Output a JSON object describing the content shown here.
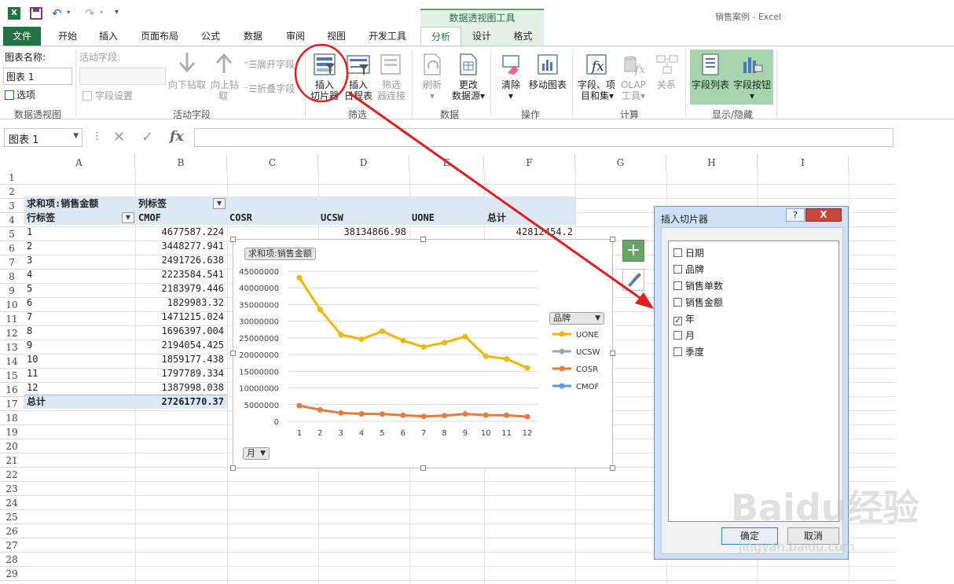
{
  "app": {
    "title": "销售案例 - Excel",
    "context_tab_group": "数据透视图工具"
  },
  "tabs": [
    {
      "label": "文件"
    },
    {
      "label": "开始"
    },
    {
      "label": "插入"
    },
    {
      "label": "页面布局"
    },
    {
      "label": "公式"
    },
    {
      "label": "数据"
    },
    {
      "label": "审阅"
    },
    {
      "label": "视图"
    },
    {
      "label": "开发工具"
    },
    {
      "label": "分析"
    },
    {
      "label": "设计"
    },
    {
      "label": "格式"
    }
  ],
  "ribbon": {
    "pivot": {
      "name_label": "图表名称:",
      "name_value": "图表 1",
      "options": "选项",
      "group": "数据透视图"
    },
    "active_field": {
      "label": "活动字段:",
      "field_settings": "字段设置",
      "drill_down": "向下钻取",
      "drill_up": "向上钻",
      "drill_up2": "取",
      "expand": "展开字段",
      "collapse": "折叠字段",
      "group": "活动字段"
    },
    "filter": {
      "slicer": "插入",
      "slicer2": "切片器",
      "timeline": "插入",
      "timeline2": "日程表",
      "connections": "筛选",
      "connections2": "器连接",
      "group": "筛选"
    },
    "data": {
      "refresh": "刷新",
      "change_source": "更改",
      "change_source2": "数据源",
      "group": "数据"
    },
    "actions": {
      "clear": "清除",
      "move_chart": "移动图表",
      "group": "操作"
    },
    "calc": {
      "fields_items": "字段、项",
      "fields_items2": "目和集",
      "olap": "OLAP",
      "olap2": "工具",
      "relations": "关系",
      "group": "计算"
    },
    "show_hide": {
      "field_list": "字段列表",
      "field_buttons": "字段按钮",
      "group": "显示/隐藏"
    }
  },
  "formula_bar": {
    "name_box": "图表 1",
    "fx": "fx",
    "formula": ""
  },
  "sheet": {
    "columns": [
      "A",
      "B",
      "C",
      "D",
      "E",
      "F",
      "G",
      "H",
      "I"
    ],
    "rows": [
      "1",
      "2",
      "3",
      "4",
      "5",
      "6",
      "7",
      "8",
      "9",
      "10",
      "11",
      "12",
      "13",
      "14",
      "15",
      "16",
      "17",
      "18",
      "19",
      "20",
      "21",
      "22",
      "23",
      "24",
      "25",
      "26",
      "27",
      "28",
      "29"
    ],
    "pivot_title": "求和项:销售金额",
    "col_labels": "列标签",
    "row_labels": "行标签",
    "col_headers": [
      "CMOF",
      "COSR",
      "UCSW",
      "UONE",
      "总计"
    ],
    "body": [
      {
        "row": "1",
        "cmof": "4677587.224",
        "ucsw": "38134866.98",
        "total": "42812454.2"
      },
      {
        "row": "2",
        "cmof": "3448277.941"
      },
      {
        "row": "3",
        "cmof": "2491726.638"
      },
      {
        "row": "4",
        "cmof": "2223584.541"
      },
      {
        "row": "5",
        "cmof": "2183979.446"
      },
      {
        "row": "6",
        "cmof": "1829983.32"
      },
      {
        "row": "7",
        "cmof": "1471215.024"
      },
      {
        "row": "8",
        "cmof": "1696397.004"
      },
      {
        "row": "9",
        "cmof": "2194054.425"
      },
      {
        "row": "10",
        "cmof": "1859177.438"
      },
      {
        "row": "11",
        "cmof": "1797789.334"
      },
      {
        "row": "12",
        "cmof": "1387998.038"
      }
    ],
    "grand_total_label": "总计",
    "grand_total_value": "27261770.37"
  },
  "chart_data": {
    "type": "line",
    "title_button": "求和项:销售金额",
    "legend_button": "品牌",
    "axis_button": "月",
    "categories": [
      "1",
      "2",
      "3",
      "4",
      "5",
      "6",
      "7",
      "8",
      "9",
      "10",
      "11",
      "12"
    ],
    "ylim": [
      0,
      45000000
    ],
    "yticks": [
      "45000000",
      "40000000",
      "35000000",
      "30000000",
      "25000000",
      "20000000",
      "15000000",
      "10000000",
      "5000000",
      "0"
    ],
    "series": [
      {
        "name": "UONE",
        "color": "#f2b500",
        "values": [
          43000000,
          33500000,
          26000000,
          24600000,
          27000000,
          24200000,
          22300000,
          23600000,
          25400000,
          19500000,
          18700000,
          16000000
        ]
      },
      {
        "name": "UCSW",
        "color": "#a5a5a5",
        "values": []
      },
      {
        "name": "COSR",
        "color": "#e87a3b",
        "values": [
          4677587,
          3448278,
          2491727,
          2223585,
          2183979,
          1829983,
          1471215,
          1696397,
          2194054,
          1859177,
          1797789,
          1387998
        ]
      },
      {
        "name": "CMOF",
        "color": "#5b9bd5",
        "values": []
      }
    ]
  },
  "dialog": {
    "title": "插入切片器",
    "help": "?",
    "close": "X",
    "fields": [
      {
        "label": "日期",
        "checked": false
      },
      {
        "label": "品牌",
        "checked": false
      },
      {
        "label": "销售单数",
        "checked": false
      },
      {
        "label": "销售金额",
        "checked": false
      },
      {
        "label": "年",
        "checked": true
      },
      {
        "label": "月",
        "checked": false
      },
      {
        "label": "季度",
        "checked": false
      }
    ],
    "ok": "确定",
    "cancel": "取消"
  },
  "colors": {
    "excel_green": "#217346",
    "annotation_red": "#e02020",
    "pivot_header": "#dce9f5"
  },
  "watermark": {
    "main": "Baidu经验",
    "sub": "jingyan.baidu.com"
  }
}
